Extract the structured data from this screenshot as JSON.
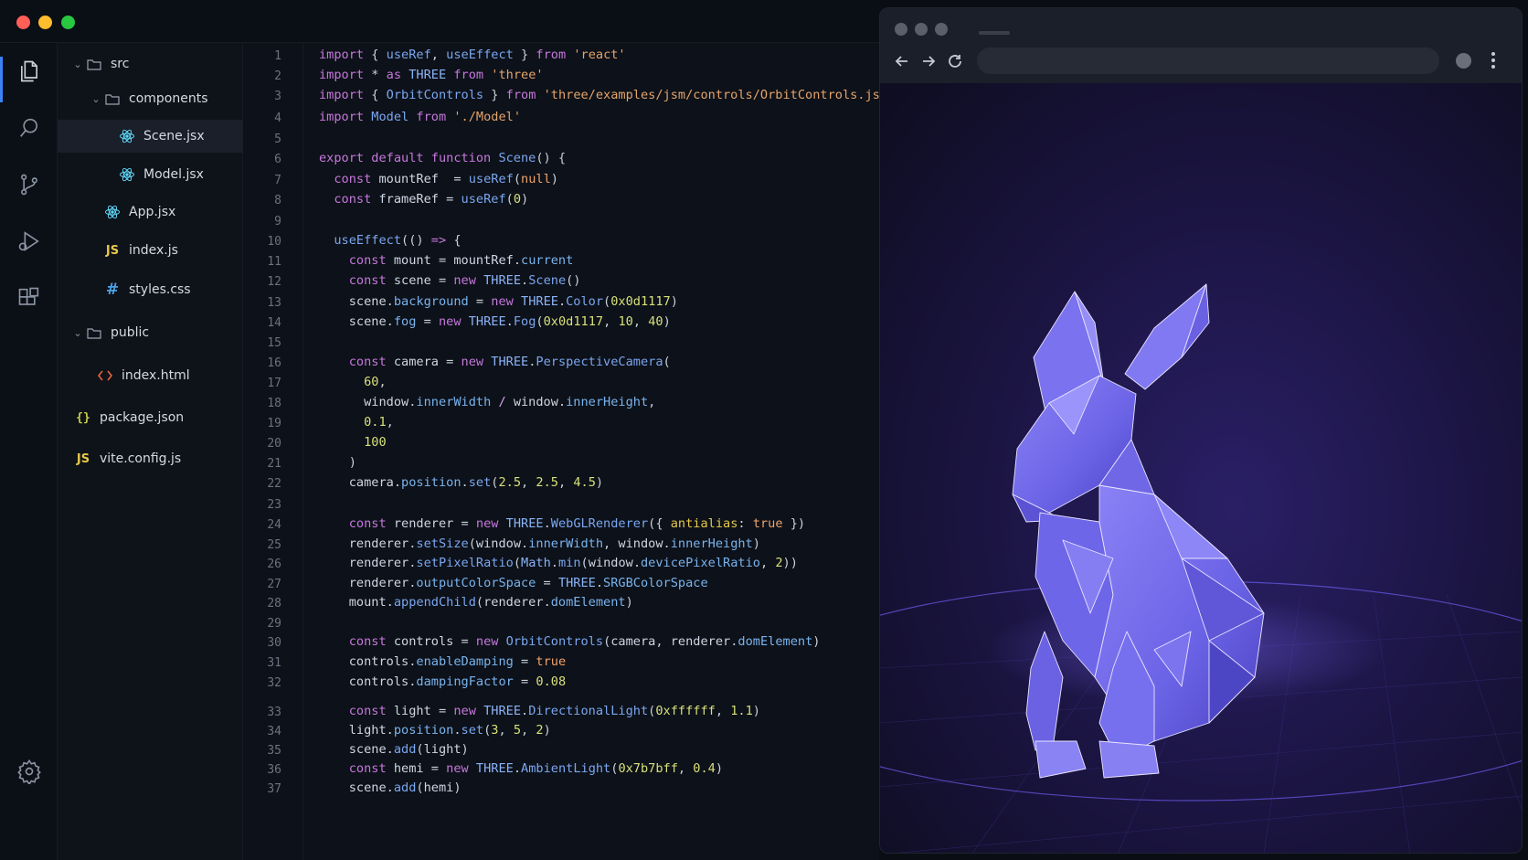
{
  "explorer": {
    "items": [
      {
        "label": "src",
        "icon": "folder-icon",
        "kind": "folder"
      },
      {
        "label": "components",
        "icon": "folder-icon",
        "kind": "folder"
      },
      {
        "label": "Scene.jsx",
        "icon": "react-icon",
        "kind": "file",
        "selected": true
      },
      {
        "label": "Model.jsx",
        "icon": "react-icon",
        "kind": "file"
      },
      {
        "label": "App.jsx",
        "icon": "react-icon",
        "kind": "file"
      },
      {
        "label": "index.js",
        "icon": "js-icon",
        "icon_text": "JS",
        "kind": "file"
      },
      {
        "label": "styles.css",
        "icon": "css-icon",
        "icon_text": "#",
        "kind": "file"
      },
      {
        "label": "public",
        "icon": "folder-icon",
        "kind": "folder"
      },
      {
        "label": "index.html",
        "icon": "html-icon",
        "kind": "file"
      },
      {
        "label": "package.json",
        "icon": "json-icon",
        "icon_text": "{}",
        "kind": "file"
      },
      {
        "label": "vite.config.js",
        "icon": "js-icon",
        "icon_text": "JS",
        "kind": "file"
      }
    ]
  },
  "activity_bar": {
    "icons": [
      "files-icon",
      "search-icon",
      "source-control-icon",
      "run-debug-icon",
      "extensions-icon",
      "settings-gear-icon"
    ]
  },
  "editor": {
    "line_numbers": [
      "1",
      "2",
      "3",
      "4",
      "5",
      "6",
      "7",
      "8",
      "9",
      "10",
      "11",
      "12",
      "13",
      "14",
      "15",
      "16",
      "17",
      "18",
      "19",
      "20",
      "21",
      "22",
      "23",
      "24",
      "25",
      "26",
      "27",
      "28",
      "29",
      "30",
      "31",
      "32",
      "33",
      "34",
      "35",
      "36",
      "37"
    ],
    "lines": [
      [
        [
          "kw",
          "import"
        ],
        [
          "pun",
          " { "
        ],
        [
          "fn",
          "useRef"
        ],
        [
          "pun",
          ", "
        ],
        [
          "fn",
          "useEffect"
        ],
        [
          "pun",
          " } "
        ],
        [
          "kw",
          "from"
        ],
        [
          "pun",
          " "
        ],
        [
          "str",
          "'react'"
        ]
      ],
      [
        [
          "kw",
          "import"
        ],
        [
          "pun",
          " * "
        ],
        [
          "kw",
          "as"
        ],
        [
          "pun",
          " "
        ],
        [
          "cls",
          "THREE"
        ],
        [
          "pun",
          " "
        ],
        [
          "kw",
          "from"
        ],
        [
          "pun",
          " "
        ],
        [
          "str",
          "'three'"
        ]
      ],
      [
        [
          "kw",
          "import"
        ],
        [
          "pun",
          " { "
        ],
        [
          "fn",
          "OrbitControls"
        ],
        [
          "pun",
          " } "
        ],
        [
          "kw",
          "from"
        ],
        [
          "pun",
          " "
        ],
        [
          "str",
          "'three/examples/jsm/controls/OrbitControls.js'"
        ]
      ],
      [
        [
          "kw",
          "import"
        ],
        [
          "pun",
          " "
        ],
        [
          "fn",
          "Model"
        ],
        [
          "pun",
          " "
        ],
        [
          "kw",
          "from"
        ],
        [
          "pun",
          " "
        ],
        [
          "str",
          "'./Model'"
        ]
      ],
      [],
      [
        [
          "kw",
          "export default function"
        ],
        [
          "pun",
          " "
        ],
        [
          "fn",
          "Scene"
        ],
        [
          "pun",
          "() {"
        ]
      ],
      [
        [
          "pun",
          "  "
        ],
        [
          "kw",
          "const"
        ],
        [
          "pun",
          " "
        ],
        [
          "var",
          "mountRef"
        ],
        [
          "pun",
          "  = "
        ],
        [
          "fn",
          "useRef"
        ],
        [
          "pun",
          "("
        ],
        [
          "lit",
          "null"
        ],
        [
          "pun",
          ")"
        ]
      ],
      [
        [
          "pun",
          "  "
        ],
        [
          "kw",
          "const"
        ],
        [
          "pun",
          " "
        ],
        [
          "var",
          "frameRef"
        ],
        [
          "pun",
          " = "
        ],
        [
          "fn",
          "useRef"
        ],
        [
          "pun",
          "("
        ],
        [
          "num",
          "0"
        ],
        [
          "pun",
          ")"
        ]
      ],
      [],
      [
        [
          "pun",
          "  "
        ],
        [
          "fn",
          "useEffect"
        ],
        [
          "pun",
          "(() "
        ],
        [
          "kw",
          "=>"
        ],
        [
          "pun",
          " {"
        ]
      ],
      [
        [
          "pun",
          "    "
        ],
        [
          "kw",
          "const"
        ],
        [
          "pun",
          " "
        ],
        [
          "var",
          "mount"
        ],
        [
          "pun",
          " = "
        ],
        [
          "var",
          "mountRef"
        ],
        [
          "pun",
          "."
        ],
        [
          "prop",
          "current"
        ]
      ],
      [
        [
          "pun",
          "    "
        ],
        [
          "kw",
          "const"
        ],
        [
          "pun",
          " "
        ],
        [
          "var",
          "scene"
        ],
        [
          "pun",
          " = "
        ],
        [
          "kw",
          "new"
        ],
        [
          "pun",
          " "
        ],
        [
          "cls",
          "THREE"
        ],
        [
          "pun",
          "."
        ],
        [
          "fn",
          "Scene"
        ],
        [
          "pun",
          "()"
        ]
      ],
      [
        [
          "pun",
          "    "
        ],
        [
          "var",
          "scene"
        ],
        [
          "pun",
          "."
        ],
        [
          "prop",
          "background"
        ],
        [
          "pun",
          " = "
        ],
        [
          "kw",
          "new"
        ],
        [
          "pun",
          " "
        ],
        [
          "cls",
          "THREE"
        ],
        [
          "pun",
          "."
        ],
        [
          "fn",
          "Color"
        ],
        [
          "pun",
          "("
        ],
        [
          "num",
          "0x0d1117"
        ],
        [
          "pun",
          ")"
        ]
      ],
      [
        [
          "pun",
          "    "
        ],
        [
          "var",
          "scene"
        ],
        [
          "pun",
          "."
        ],
        [
          "prop",
          "fog"
        ],
        [
          "pun",
          " = "
        ],
        [
          "kw",
          "new"
        ],
        [
          "pun",
          " "
        ],
        [
          "cls",
          "THREE"
        ],
        [
          "pun",
          "."
        ],
        [
          "fn",
          "Fog"
        ],
        [
          "pun",
          "("
        ],
        [
          "num",
          "0x0d1117"
        ],
        [
          "pun",
          ", "
        ],
        [
          "num",
          "10"
        ],
        [
          "pun",
          ", "
        ],
        [
          "num",
          "40"
        ],
        [
          "pun",
          ")"
        ]
      ],
      [],
      [
        [
          "pun",
          "    "
        ],
        [
          "kw",
          "const"
        ],
        [
          "pun",
          " "
        ],
        [
          "var",
          "camera"
        ],
        [
          "pun",
          " = "
        ],
        [
          "kw",
          "new"
        ],
        [
          "pun",
          " "
        ],
        [
          "cls",
          "THREE"
        ],
        [
          "pun",
          "."
        ],
        [
          "fn",
          "PerspectiveCamera"
        ],
        [
          "pun",
          "("
        ]
      ],
      [
        [
          "pun",
          "      "
        ],
        [
          "num",
          "60"
        ],
        [
          "pun",
          ","
        ]
      ],
      [
        [
          "pun",
          "      "
        ],
        [
          "var",
          "window"
        ],
        [
          "pun",
          "."
        ],
        [
          "prop",
          "innerWidth"
        ],
        [
          "pun",
          " "
        ],
        [
          "op",
          "/"
        ],
        [
          "pun",
          " "
        ],
        [
          "var",
          "window"
        ],
        [
          "pun",
          "."
        ],
        [
          "prop",
          "innerHeight"
        ],
        [
          "pun",
          ","
        ]
      ],
      [
        [
          "pun",
          "      "
        ],
        [
          "num",
          "0.1"
        ],
        [
          "pun",
          ","
        ]
      ],
      [
        [
          "pun",
          "      "
        ],
        [
          "num",
          "100"
        ]
      ],
      [
        [
          "pun",
          "    )"
        ]
      ],
      [
        [
          "pun",
          "    "
        ],
        [
          "var",
          "camera"
        ],
        [
          "pun",
          "."
        ],
        [
          "prop",
          "position"
        ],
        [
          "pun",
          "."
        ],
        [
          "fn",
          "set"
        ],
        [
          "pun",
          "("
        ],
        [
          "num",
          "2.5"
        ],
        [
          "pun",
          ", "
        ],
        [
          "num",
          "2.5"
        ],
        [
          "pun",
          ", "
        ],
        [
          "num",
          "4.5"
        ],
        [
          "pun",
          ")"
        ]
      ],
      [],
      [
        [
          "pun",
          "    "
        ],
        [
          "kw",
          "const"
        ],
        [
          "pun",
          " "
        ],
        [
          "var",
          "renderer"
        ],
        [
          "pun",
          " = "
        ],
        [
          "kw",
          "new"
        ],
        [
          "pun",
          " "
        ],
        [
          "cls",
          "THREE"
        ],
        [
          "pun",
          "."
        ],
        [
          "fn",
          "WebGLRenderer"
        ],
        [
          "pun",
          "({ "
        ],
        [
          "attr",
          "antialias"
        ],
        [
          "pun",
          ": "
        ],
        [
          "lit",
          "true"
        ],
        [
          "pun",
          " })"
        ]
      ],
      [
        [
          "pun",
          "    "
        ],
        [
          "var",
          "renderer"
        ],
        [
          "pun",
          "."
        ],
        [
          "fn",
          "setSize"
        ],
        [
          "pun",
          "("
        ],
        [
          "var",
          "window"
        ],
        [
          "pun",
          "."
        ],
        [
          "prop",
          "innerWidth"
        ],
        [
          "pun",
          ", "
        ],
        [
          "var",
          "window"
        ],
        [
          "pun",
          "."
        ],
        [
          "prop",
          "innerHeight"
        ],
        [
          "pun",
          ")"
        ]
      ],
      [
        [
          "pun",
          "    "
        ],
        [
          "var",
          "renderer"
        ],
        [
          "pun",
          "."
        ],
        [
          "fn",
          "setPixelRatio"
        ],
        [
          "pun",
          "("
        ],
        [
          "cls",
          "Math"
        ],
        [
          "pun",
          "."
        ],
        [
          "fn",
          "min"
        ],
        [
          "pun",
          "("
        ],
        [
          "var",
          "window"
        ],
        [
          "pun",
          "."
        ],
        [
          "prop",
          "devicePixelRatio"
        ],
        [
          "pun",
          ", "
        ],
        [
          "num",
          "2"
        ],
        [
          "pun",
          "))"
        ]
      ],
      [
        [
          "pun",
          "    "
        ],
        [
          "var",
          "renderer"
        ],
        [
          "pun",
          "."
        ],
        [
          "prop",
          "outputColorSpace"
        ],
        [
          "pun",
          " = "
        ],
        [
          "cls",
          "THREE"
        ],
        [
          "pun",
          "."
        ],
        [
          "prop",
          "SRGBColorSpace"
        ]
      ],
      [
        [
          "pun",
          "    "
        ],
        [
          "var",
          "mount"
        ],
        [
          "pun",
          "."
        ],
        [
          "fn",
          "appendChild"
        ],
        [
          "pun",
          "("
        ],
        [
          "var",
          "renderer"
        ],
        [
          "pun",
          "."
        ],
        [
          "prop",
          "domElement"
        ],
        [
          "pun",
          ")"
        ]
      ],
      [],
      [
        [
          "pun",
          "    "
        ],
        [
          "kw",
          "const"
        ],
        [
          "pun",
          " "
        ],
        [
          "var",
          "controls"
        ],
        [
          "pun",
          " = "
        ],
        [
          "kw",
          "new"
        ],
        [
          "pun",
          " "
        ],
        [
          "fn",
          "OrbitControls"
        ],
        [
          "pun",
          "("
        ],
        [
          "var",
          "camera"
        ],
        [
          "pun",
          ", "
        ],
        [
          "var",
          "renderer"
        ],
        [
          "pun",
          "."
        ],
        [
          "prop",
          "domElement"
        ],
        [
          "pun",
          ")"
        ]
      ],
      [
        [
          "pun",
          "    "
        ],
        [
          "var",
          "controls"
        ],
        [
          "pun",
          "."
        ],
        [
          "prop",
          "enableDamping"
        ],
        [
          "pun",
          " = "
        ],
        [
          "lit",
          "true"
        ]
      ],
      [
        [
          "pun",
          "    "
        ],
        [
          "var",
          "controls"
        ],
        [
          "pun",
          "."
        ],
        [
          "prop",
          "dampingFactor"
        ],
        [
          "pun",
          " = "
        ],
        [
          "num",
          "0.08"
        ]
      ],
      [
        [
          "pun",
          "    "
        ],
        [
          "kw",
          "const"
        ],
        [
          "pun",
          " "
        ],
        [
          "var",
          "light"
        ],
        [
          "pun",
          " = "
        ],
        [
          "kw",
          "new"
        ],
        [
          "pun",
          " "
        ],
        [
          "cls",
          "THREE"
        ],
        [
          "pun",
          "."
        ],
        [
          "fn",
          "DirectionalLight"
        ],
        [
          "pun",
          "("
        ],
        [
          "num",
          "0xffffff"
        ],
        [
          "pun",
          ", "
        ],
        [
          "num",
          "1.1"
        ],
        [
          "pun",
          ")"
        ]
      ],
      [
        [
          "pun",
          "    "
        ],
        [
          "var",
          "light"
        ],
        [
          "pun",
          "."
        ],
        [
          "prop",
          "position"
        ],
        [
          "pun",
          "."
        ],
        [
          "fn",
          "set"
        ],
        [
          "pun",
          "("
        ],
        [
          "num",
          "3"
        ],
        [
          "pun",
          ", "
        ],
        [
          "num",
          "5"
        ],
        [
          "pun",
          ", "
        ],
        [
          "num",
          "2"
        ],
        [
          "pun",
          ")"
        ]
      ],
      [
        [
          "pun",
          "    "
        ],
        [
          "var",
          "scene"
        ],
        [
          "pun",
          "."
        ],
        [
          "fn",
          "add"
        ],
        [
          "pun",
          "("
        ],
        [
          "var",
          "light"
        ],
        [
          "pun",
          ")"
        ]
      ],
      [
        [
          "pun",
          "    "
        ],
        [
          "kw",
          "const"
        ],
        [
          "pun",
          " "
        ],
        [
          "var",
          "hemi"
        ],
        [
          "pun",
          " = "
        ],
        [
          "kw",
          "new"
        ],
        [
          "pun",
          " "
        ],
        [
          "cls",
          "THREE"
        ],
        [
          "pun",
          "."
        ],
        [
          "fn",
          "AmbientLight"
        ],
        [
          "pun",
          "("
        ],
        [
          "num",
          "0x7b7bff"
        ],
        [
          "pun",
          ", "
        ],
        [
          "num",
          "0.4"
        ],
        [
          "pun",
          ")"
        ]
      ],
      [
        [
          "pun",
          "    "
        ],
        [
          "var",
          "scene"
        ],
        [
          "pun",
          "."
        ],
        [
          "fn",
          "add"
        ],
        [
          "pun",
          "("
        ],
        [
          "var",
          "hemi"
        ],
        [
          "pun",
          ")"
        ]
      ]
    ]
  },
  "browser": {
    "url": "",
    "nav_icons": [
      "back-arrow-icon",
      "forward-arrow-icon",
      "reload-icon"
    ]
  },
  "colors": {
    "accent": "#3b82f6",
    "bunny": "#6b63e6",
    "viewport_bg": "#1a1440"
  }
}
